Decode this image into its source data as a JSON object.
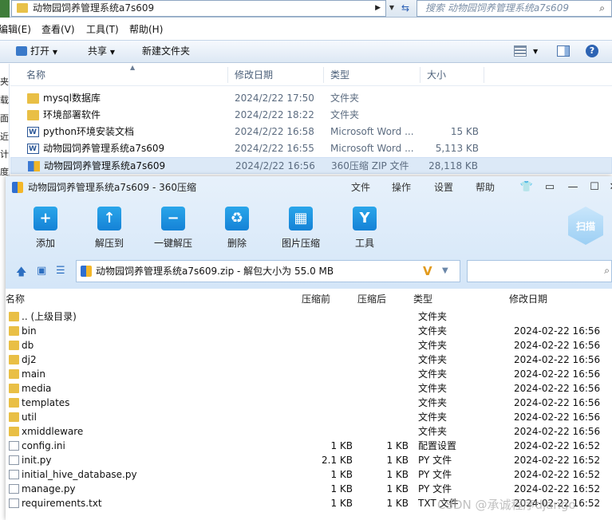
{
  "explorer": {
    "breadcrumb": "动物园饲养管理系统a7s609",
    "search_placeholder": "搜索 动物园饲养管理系统a7s609",
    "menu": [
      "编辑(E)",
      "查看(V)",
      "工具(T)",
      "帮助(H)"
    ],
    "toolbar": {
      "open": "打开",
      "share": "共享",
      "new_folder": "新建文件夹"
    },
    "left_pane_chars": [
      "夹",
      "载",
      "面",
      "近",
      "计",
      "度",
      "e"
    ],
    "columns": {
      "name": "名称",
      "date": "修改日期",
      "type": "类型",
      "size": "大小"
    },
    "files": [
      {
        "icon": "folder",
        "name": "mysql数据库",
        "date": "2024/2/22 17:50",
        "type": "文件夹",
        "size": ""
      },
      {
        "icon": "folder",
        "name": "环境部署软件",
        "date": "2024/2/22 18:22",
        "type": "文件夹",
        "size": ""
      },
      {
        "icon": "word",
        "name": "python环境安装文档",
        "date": "2024/2/22 16:58",
        "type": "Microsoft Word ...",
        "size": "15 KB"
      },
      {
        "icon": "word",
        "name": "动物园饲养管理系统a7s609",
        "date": "2024/2/22 16:55",
        "type": "Microsoft Word ...",
        "size": "5,113 KB"
      },
      {
        "icon": "zip",
        "name": "动物园饲养管理系统a7s609",
        "date": "2024/2/22 16:56",
        "type": "360压缩 ZIP 文件",
        "size": "28,118 KB"
      }
    ]
  },
  "zip": {
    "title": "动物园饲养管理系统a7s609 - 360压缩",
    "menu": [
      "文件",
      "操作",
      "设置",
      "帮助"
    ],
    "tools": [
      {
        "icon": "add-icon",
        "glyph": "+",
        "label": "添加"
      },
      {
        "icon": "extract-to-icon",
        "glyph": "↑",
        "label": "解压到"
      },
      {
        "icon": "one-click-extract-icon",
        "glyph": "−",
        "label": "一键解压"
      },
      {
        "icon": "delete-icon",
        "glyph": "♻",
        "label": "删除"
      },
      {
        "icon": "image-compress-icon",
        "glyph": "▦",
        "label": "图片压缩"
      },
      {
        "icon": "tools-icon",
        "glyph": "Y",
        "label": "工具"
      }
    ],
    "scan_label": "扫描",
    "address": "动物园饲养管理系统a7s609.zip - 解包大小为 55.0 MB",
    "columns": {
      "name": "名称",
      "before": "压缩前",
      "after": "压缩后",
      "type": "类型",
      "modified": "修改日期"
    },
    "entries": [
      {
        "icon": "folder",
        "name": ".. (上级目录)",
        "before": "",
        "after": "",
        "type": "文件夹",
        "modified": ""
      },
      {
        "icon": "folder",
        "name": "bin",
        "before": "",
        "after": "",
        "type": "文件夹",
        "modified": "2024-02-22 16:56"
      },
      {
        "icon": "folder",
        "name": "db",
        "before": "",
        "after": "",
        "type": "文件夹",
        "modified": "2024-02-22 16:56"
      },
      {
        "icon": "folder",
        "name": "dj2",
        "before": "",
        "after": "",
        "type": "文件夹",
        "modified": "2024-02-22 16:56"
      },
      {
        "icon": "folder",
        "name": "main",
        "before": "",
        "after": "",
        "type": "文件夹",
        "modified": "2024-02-22 16:56"
      },
      {
        "icon": "folder",
        "name": "media",
        "before": "",
        "after": "",
        "type": "文件夹",
        "modified": "2024-02-22 16:56"
      },
      {
        "icon": "folder",
        "name": "templates",
        "before": "",
        "after": "",
        "type": "文件夹",
        "modified": "2024-02-22 16:56"
      },
      {
        "icon": "folder",
        "name": "util",
        "before": "",
        "after": "",
        "type": "文件夹",
        "modified": "2024-02-22 16:56"
      },
      {
        "icon": "folder",
        "name": "xmiddleware",
        "before": "",
        "after": "",
        "type": "文件夹",
        "modified": "2024-02-22 16:56"
      },
      {
        "icon": "cfg",
        "name": "config.ini",
        "before": "1 KB",
        "after": "1 KB",
        "type": "配置设置",
        "modified": "2024-02-22 16:52"
      },
      {
        "icon": "file",
        "name": "init.py",
        "before": "2.1 KB",
        "after": "1 KB",
        "type": "PY 文件",
        "modified": "2024-02-22 16:52"
      },
      {
        "icon": "file",
        "name": "initial_hive_database.py",
        "before": "1 KB",
        "after": "1 KB",
        "type": "PY 文件",
        "modified": "2024-02-22 16:52"
      },
      {
        "icon": "file",
        "name": "manage.py",
        "before": "1 KB",
        "after": "1 KB",
        "type": "PY 文件",
        "modified": "2024-02-22 16:52"
      },
      {
        "icon": "file",
        "name": "requirements.txt",
        "before": "1 KB",
        "after": "1 KB",
        "type": "TXT 文件",
        "modified": "2024-02-22 16:52"
      }
    ]
  },
  "watermark": "CSDN @承诚程序django"
}
